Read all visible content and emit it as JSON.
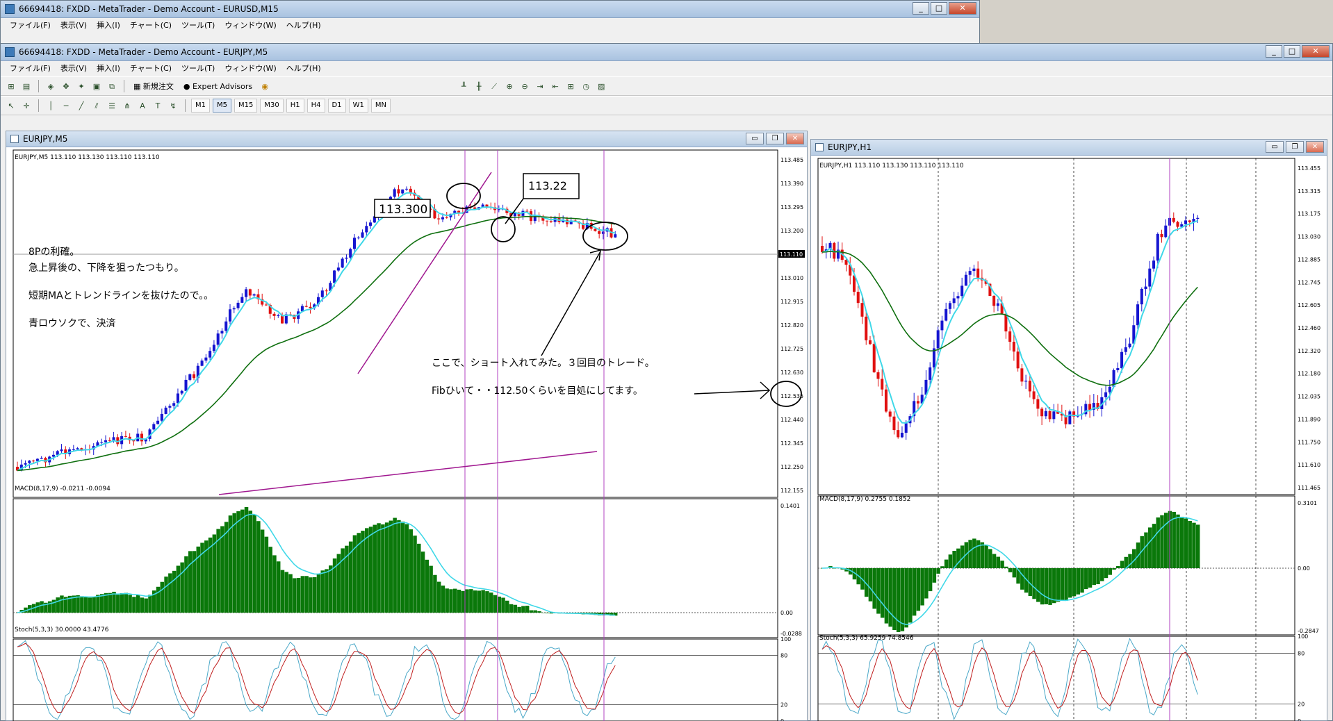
{
  "back_window": {
    "title": "66694418: FXDD - MetaTrader - Demo Account - EURUSD,M15",
    "menu": [
      "ファイル(F)",
      "表示(V)",
      "挿入(I)",
      "チャート(C)",
      "ツール(T)",
      "ウィンドウ(W)",
      "ヘルプ(H)"
    ],
    "toolbar": {
      "new_order": "新規注文",
      "expert_advisors": "Expert Advisors"
    }
  },
  "main_window": {
    "title": "66694418: FXDD - MetaTrader - Demo Account - EURJPY,M5",
    "menu": [
      "ファイル(F)",
      "表示(V)",
      "挿入(I)",
      "チャート(C)",
      "ツール(T)",
      "ウィンドウ(W)",
      "ヘルプ(H)"
    ],
    "toolbar": {
      "new_order": "新規注文",
      "expert_advisors": "Expert Advisors"
    },
    "timeframes": [
      "M1",
      "M5",
      "M15",
      "M30",
      "H1",
      "H4",
      "D1",
      "W1",
      "MN"
    ],
    "active_timeframe": "M5"
  },
  "chart_m5": {
    "window_title": "EURJPY,M5",
    "info": "EURJPY,M5  113.110 113.130 113.110 113.110",
    "price_axis": [
      "113.485",
      "113.390",
      "113.295",
      "113.200",
      "113.110",
      "113.010",
      "112.915",
      "112.820",
      "112.725",
      "112.630",
      "112.535",
      "112.440",
      "112.345",
      "112.250",
      "112.155"
    ],
    "current_price": "113.110",
    "macd_label": "MACD(8,17,9) -0.0211 -0.0094",
    "macd_axis": [
      "0.1401",
      "0.00",
      "-0.0288"
    ],
    "stoch_label": "Stoch(5,3,3) 30.0000 43.4776",
    "stoch_axis": [
      "100",
      "80",
      "20",
      "0"
    ],
    "annotations": {
      "box1": "113.300",
      "box2": "113.22",
      "note_lines": [
        "8Pの利確。",
        "急上昇後の、下降を狙ったつもり。",
        "短期MAとトレンドラインを抜けたので。。",
        "青ロウソクで、決済"
      ],
      "trade_note": "ここで、ショート入れてみた。３回目のトレード。",
      "fib_note": "Fibひいて・・112.50くらいを目処にしてます。"
    }
  },
  "chart_h1": {
    "window_title": "EURJPY,H1",
    "info": "EURJPY,H1  113.110 113.130 113.110 113.110",
    "price_axis": [
      "113.455",
      "113.315",
      "113.175",
      "113.030",
      "112.885",
      "112.745",
      "112.605",
      "112.460",
      "112.320",
      "112.180",
      "112.035",
      "111.890",
      "111.750",
      "111.610",
      "111.465"
    ],
    "current_price": "113.110",
    "macd_label": "MACD(8,17,9) 0.2755 0.1852",
    "macd_axis": [
      "0.3101",
      "0.00",
      "-0.2847"
    ],
    "stoch_label": "Stoch(5,3,3) 65.9259 74.8546",
    "stoch_axis": [
      "100",
      "80",
      "20",
      "0"
    ]
  },
  "colors": {
    "bull": "#1515d0",
    "bear": "#e01010",
    "ma_short": "#40d8e8",
    "ma_long": "#107010",
    "macd_hist": "#0a780a",
    "marker": "#b040c0"
  }
}
